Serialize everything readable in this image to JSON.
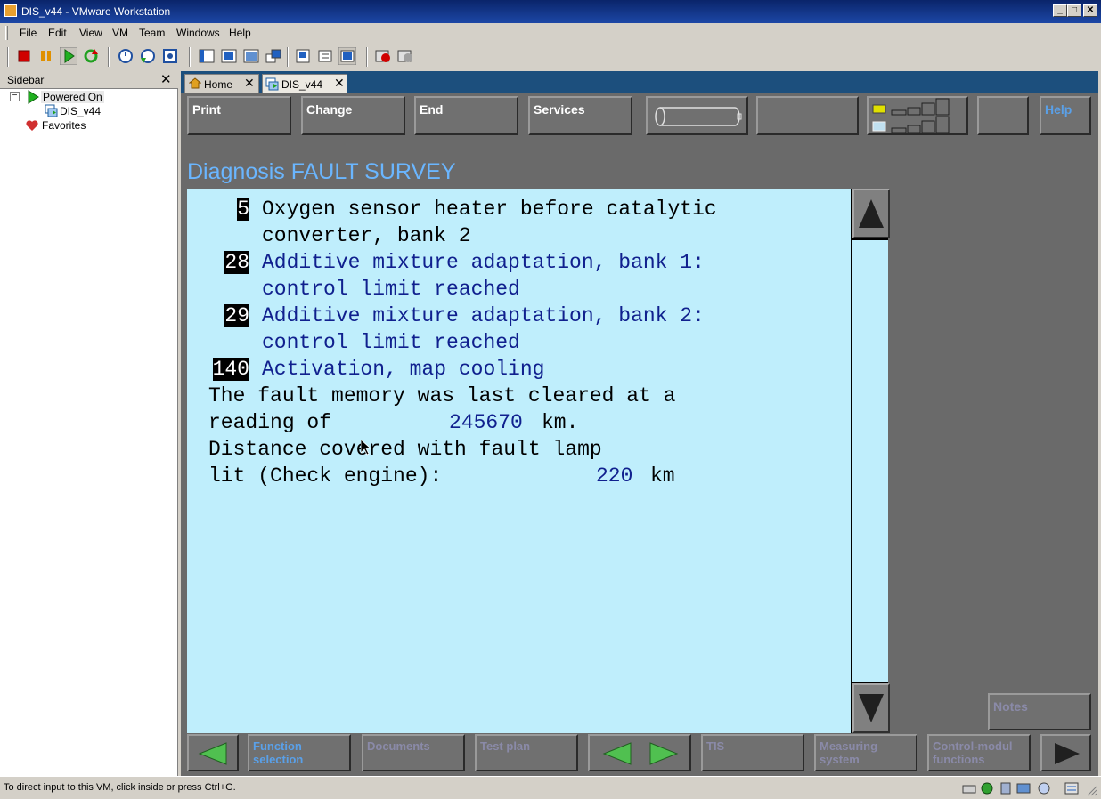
{
  "window": {
    "title": "DIS_v44 - VMware Workstation",
    "minimize": "_",
    "maximize": "□",
    "close": "✕"
  },
  "menu": [
    "File",
    "Edit",
    "View",
    "VM",
    "Team",
    "Windows",
    "Help"
  ],
  "sidebar": {
    "header": "Sidebar",
    "close": "✕",
    "tree": {
      "group": "Powered On",
      "vm": "DIS_v44",
      "favorites": "Favorites"
    }
  },
  "tabs": {
    "home": "Home",
    "vm": "DIS_v44"
  },
  "guest": {
    "top_buttons": {
      "print": "Print",
      "change": "Change",
      "end": "End",
      "services": "Services",
      "help": "Help"
    },
    "title": "Diagnosis  FAULT SURVEY",
    "faults": [
      {
        "code": "5",
        "line1": "Oxygen sensor heater before catalytic",
        "line2": "converter, bank 2"
      },
      {
        "code": "28",
        "line1": "Additive mixture adaptation, bank 1:",
        "line2": "control limit reached"
      },
      {
        "code": "29",
        "line1": "Additive mixture adaptation, bank 2:",
        "line2": "control limit reached"
      },
      {
        "code": "140",
        "line1": "Activation, map cooling"
      }
    ],
    "memory_text_1": "The fault memory was last cleared at a",
    "memory_text_2_prefix": "reading of",
    "memory_value": "245670",
    "memory_unit": "km.",
    "distance_text_1": "Distance covered with fault lamp",
    "distance_text_2_prefix": "lit (Check engine):",
    "distance_value": "220",
    "distance_unit": "km",
    "notes": "Notes",
    "bottom_buttons": {
      "function_selection_1": "Function",
      "function_selection_2": "selection",
      "documents": "Documents",
      "test_plan": "Test plan",
      "tis": "TIS",
      "measuring_1": "Measuring",
      "measuring_2": "system",
      "control_1": "Control-modul",
      "control_2": "functions"
    }
  },
  "status": "To direct input to this VM, click inside or press Ctrl+G."
}
